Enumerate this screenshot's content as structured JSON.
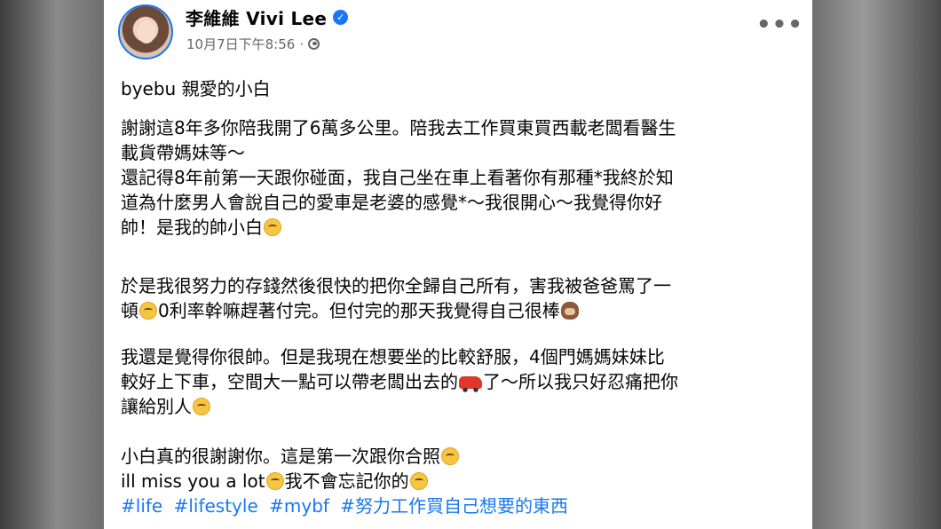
{
  "author": {
    "name": "李維維 Vivi Lee",
    "verified_icon": "verified-badge-icon",
    "timestamp": "10月7日下午8:56",
    "separator": "·",
    "privacy_icon": "globe-icon"
  },
  "menu": {
    "more_label": "•••"
  },
  "post": {
    "p1": {
      "l1": "byebu 親愛的小白"
    },
    "p2": {
      "l1": "謝謝這8年多你陪我開了6萬多公里。陪我去工作買東買西載老闆看醫生",
      "l2": "載貨帶媽妹等～",
      "l3": "還記得8年前第一天跟你碰面，我自己坐在車上看著你有那種*我終於知",
      "l4": "道為什麼男人會說自己的愛車是老婆的感覺*～我很開心～我覺得你好",
      "l5": "帥！是我的帥小白"
    },
    "p3": {
      "l1": "於是我很努力的存錢然後很快的把你全歸自己所有，害我被爸爸罵了一",
      "l2a": "頓",
      "l2b": "0利率幹嘛趕著付完。但付完的那天我覺得自己很棒"
    },
    "p4": {
      "l1": "我還是覺得你很帥。但是我現在想要坐的比較舒服，4個門媽媽妹妹比",
      "l2a": "較好上下車，空間大一點可以帶老闆出去的",
      "l2b": "了～所以我只好忍痛把你",
      "l3": "讓給別人"
    },
    "p5": {
      "l1": "小白真的很謝謝你。這是第一次跟你合照",
      "l2a": "ill miss you a lot",
      "l2b": "我不會忘記你的"
    },
    "hashtags": [
      "#life",
      "#lifestyle",
      "#mybf",
      "#努力工作買自己想要的東西"
    ],
    "emojis": [
      "smiling-face-icon",
      "rolling-laughing-face-icon",
      "see-no-evil-monkey-icon",
      "car-icon",
      "crying-face-icon",
      "relieved-face-icon",
      "grinning-face-icon",
      "winking-face-icon"
    ]
  },
  "colors": {
    "link": "#1877f2",
    "text": "#050505",
    "meta": "#65676b"
  }
}
